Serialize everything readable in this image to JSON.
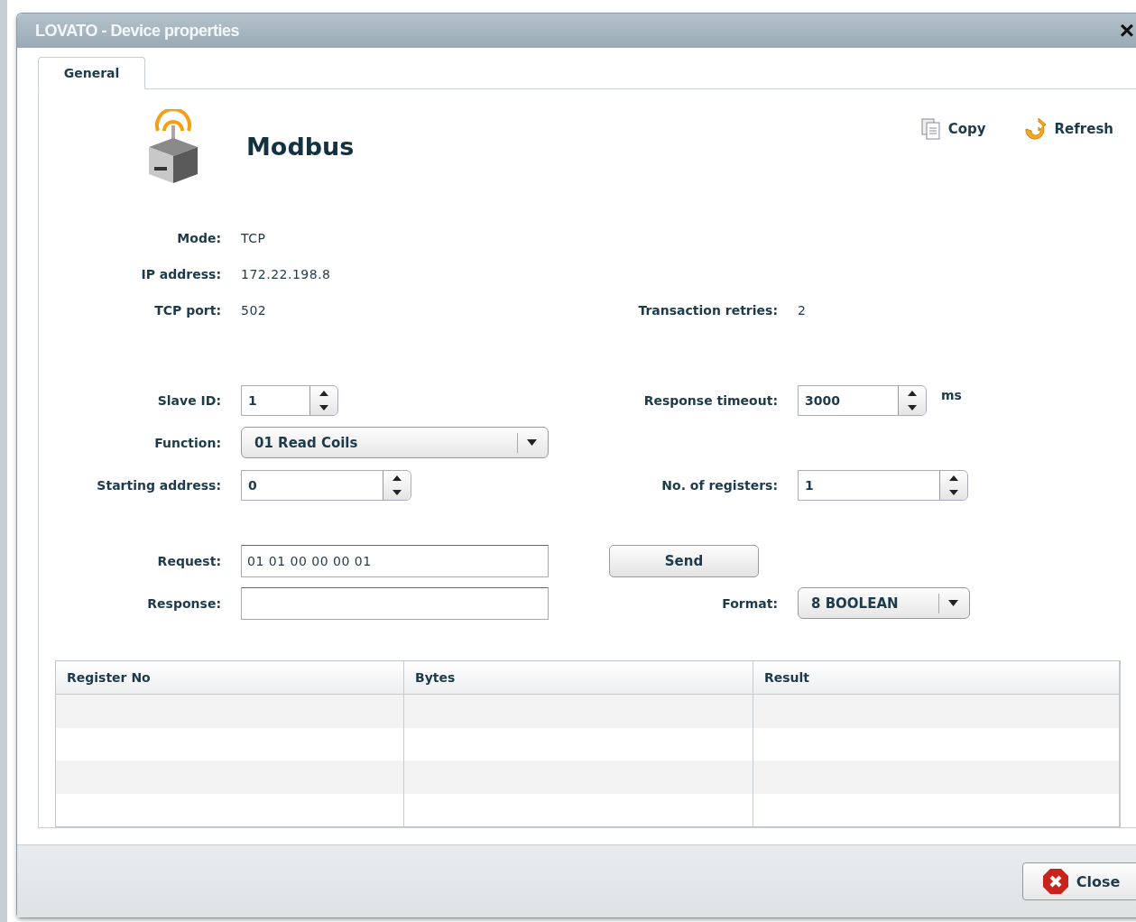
{
  "window": {
    "title": "LOVATO - Device properties",
    "close": "×"
  },
  "tabs": [
    {
      "label": "General",
      "selected": true
    }
  ],
  "header": {
    "title": "Modbus",
    "actions": [
      {
        "kind": "copy",
        "label": "Copy"
      },
      {
        "kind": "refresh",
        "label": "Refresh"
      }
    ]
  },
  "info": [
    {
      "label": "Mode:",
      "value": "TCP"
    },
    {
      "label": "IP address:",
      "value": "172.22.198.8"
    },
    {
      "label": "TCP port:",
      "value": "502",
      "right_label": "Transaction retries:",
      "right_value": "2"
    }
  ],
  "slave_id": {
    "label": "Slave ID:",
    "value": "1"
  },
  "response_timeout": {
    "label": "Response timeout:",
    "value": "3000",
    "unit": "ms"
  },
  "function": {
    "label": "Function:",
    "value": "01 Read Coils"
  },
  "starting_address": {
    "label": "Starting address:",
    "value": "0"
  },
  "registers": {
    "label": "No. of registers:",
    "value": "1"
  },
  "request": {
    "label": "Request:",
    "value": "01 01 00 00 00 01"
  },
  "response": {
    "label": "Response:"
  },
  "send_button": "Send",
  "format": {
    "label": "Format:",
    "value": "8 BOOLEAN"
  },
  "table": {
    "columns": [
      "Register No",
      "Bytes",
      "Result"
    ]
  },
  "footer": {
    "close_button": "Close"
  }
}
